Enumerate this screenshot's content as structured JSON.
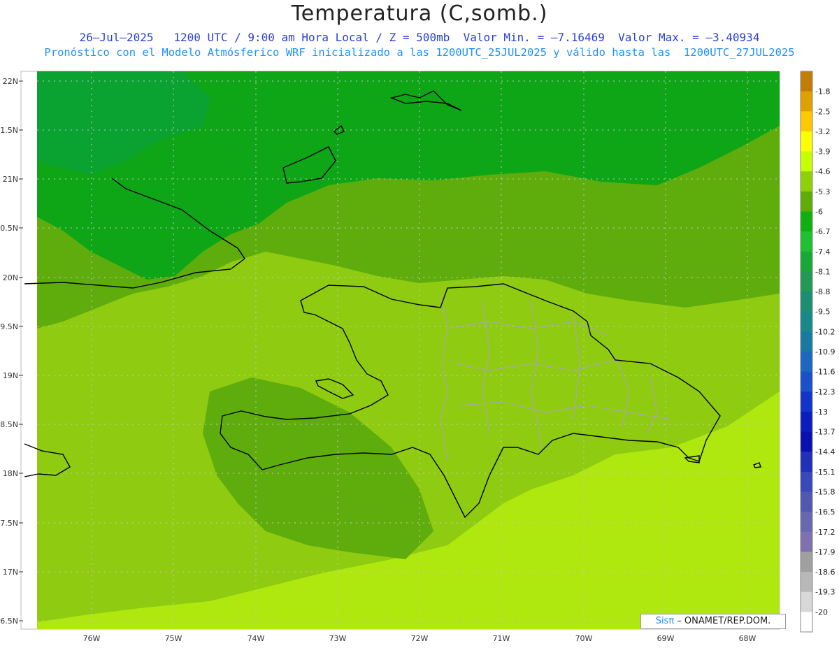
{
  "header": {
    "title": "Temperatura (C,somb.)",
    "subtitle1": "26–Jul–2025   1200 UTC / 9:00 am Hora Local / Z = 500mb  Valor Min. = –7.16469  Valor Max. = –3.40934",
    "subtitle2": "Pronóstico con el Modelo Atmósferico WRF inicializado a las 1200UTC_25JUL2025 y válido hasta las  1200UTC_27JUL2025"
  },
  "map": {
    "lat_labels": [
      "22N",
      "1.5N",
      "21N",
      "0.5N",
      "20N",
      "9.5N",
      "19N",
      "8.5N",
      "18N",
      "7.5N",
      "17N",
      "6.5N"
    ],
    "lon_labels": [
      "76W",
      "75W",
      "74W",
      "73W",
      "72W",
      "71W",
      "70W",
      "69W",
      "68W"
    ],
    "colors": {
      "band_dark": "#0ea517",
      "band_mid": "#5fad0c",
      "band_light": "#8fcb10",
      "band_lighter": "#aee80e",
      "coast": "#000000",
      "borders": "#a8a8a8"
    }
  },
  "colorbar": {
    "labels": [
      "-1.8",
      "-2.5",
      "-3.2",
      "-3.9",
      "-4.6",
      "-5.3",
      "-6",
      "-6.7",
      "-7.4",
      "-8.1",
      "-8.8",
      "-9.5",
      "-10.2",
      "-10.9",
      "-11.6",
      "-12.3",
      "-13",
      "-13.7",
      "-14.4",
      "-15.1",
      "-15.8",
      "-16.5",
      "-17.2",
      "-17.9",
      "-18.6",
      "-19.3",
      "-20"
    ],
    "colors": [
      "#c17d05",
      "#e0a000",
      "#ffc800",
      "#ffff00",
      "#c8ff00",
      "#90d008",
      "#60ac06",
      "#10b010",
      "#20c030",
      "#18a838",
      "#229955",
      "#1c8e72",
      "#188888",
      "#187aa0",
      "#1c68c0",
      "#1a50c8",
      "#1234c8",
      "#0a1ec0",
      "#0a10b0",
      "#2030b8",
      "#3848b8",
      "#5058b0",
      "#6868b0",
      "#8070b0",
      "#a0a0a0",
      "#b8b8b8",
      "#d8d8d8",
      "#ffffff"
    ]
  },
  "credit": {
    "sis": "Sisπ",
    "text": " – ONAMET/REP.DOM."
  }
}
